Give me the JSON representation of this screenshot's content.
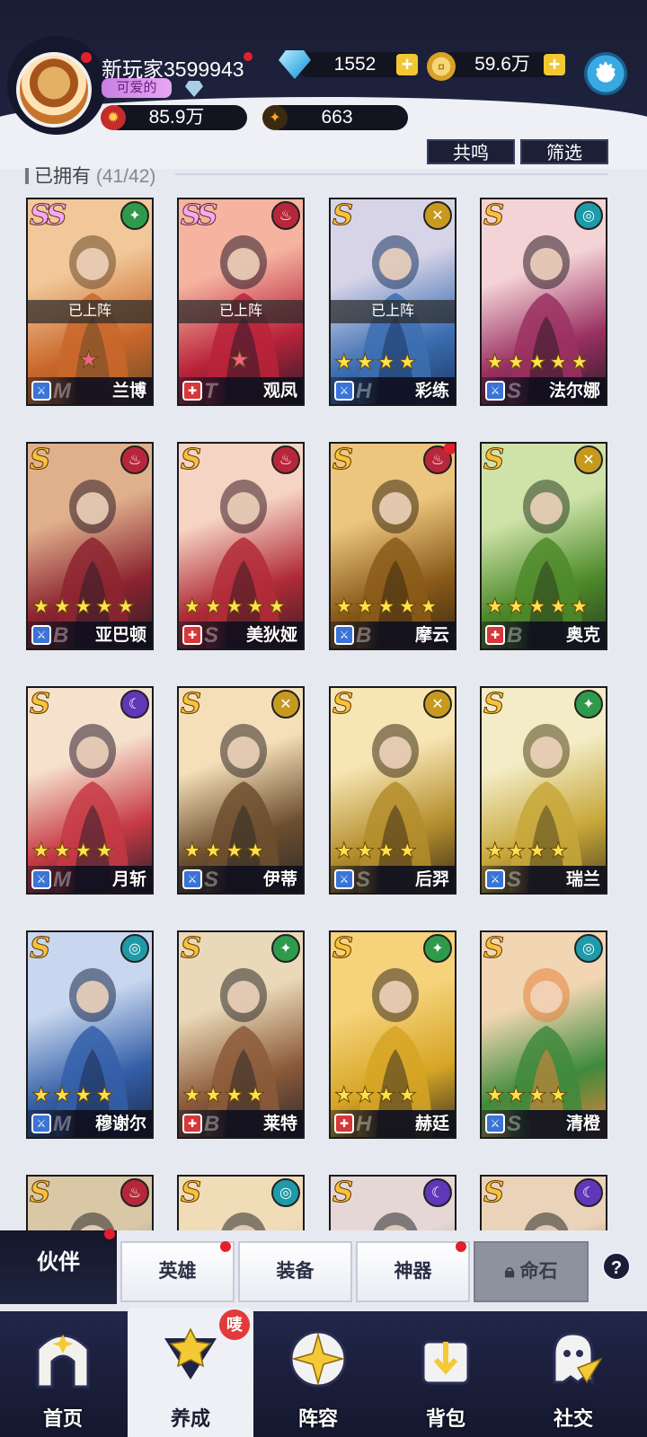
{
  "player": {
    "name": "新玩家3599943",
    "title": "可爱的",
    "power": "85.9万",
    "stars": "663"
  },
  "currency": {
    "diamonds": "1552",
    "gold": "59.6万"
  },
  "actions": {
    "resonance": "共鸣",
    "filter": "筛选"
  },
  "owned": {
    "label": "已拥有",
    "count": "(41/42)"
  },
  "deployed_label": "已上阵",
  "heroes": [
    {
      "name": "兰博",
      "rank": "SS",
      "faction": "green",
      "stars": 1,
      "star_color": "pink",
      "deployed": true,
      "class": "blue",
      "tier": "M"
    },
    {
      "name": "观凤",
      "rank": "SS",
      "faction": "red",
      "stars": 1,
      "star_color": "pink",
      "deployed": true,
      "class": "red",
      "tier": "T"
    },
    {
      "name": "彩练",
      "rank": "S",
      "faction": "gold",
      "stars": 4,
      "star_color": "gold",
      "deployed": true,
      "class": "blue",
      "tier": "H"
    },
    {
      "name": "法尔娜",
      "rank": "S",
      "faction": "teal",
      "stars": 5,
      "star_color": "gold",
      "deployed": false,
      "class": "blue",
      "tier": "S"
    },
    {
      "name": "亚巴顿",
      "rank": "S",
      "faction": "red",
      "stars": 5,
      "star_color": "gold",
      "deployed": false,
      "class": "blue",
      "tier": "B"
    },
    {
      "name": "美狄娅",
      "rank": "S",
      "faction": "red",
      "stars": 5,
      "star_color": "gold",
      "deployed": false,
      "class": "red",
      "tier": "S"
    },
    {
      "name": "摩云",
      "rank": "S",
      "faction": "red",
      "stars": 5,
      "star_color": "gold",
      "deployed": false,
      "class": "blue",
      "tier": "B",
      "alert": true
    },
    {
      "name": "奥克",
      "rank": "S",
      "faction": "gold",
      "stars": 5,
      "star_color": "gold",
      "deployed": false,
      "class": "red",
      "tier": "B"
    },
    {
      "name": "月斩",
      "rank": "S",
      "faction": "purple",
      "stars": 4,
      "star_color": "gold",
      "deployed": false,
      "class": "blue",
      "tier": "M"
    },
    {
      "name": "伊蒂",
      "rank": "S",
      "faction": "gold",
      "stars": 4,
      "star_color": "gold",
      "deployed": false,
      "class": "blue",
      "tier": "S"
    },
    {
      "name": "后羿",
      "rank": "S",
      "faction": "gold",
      "stars": 4,
      "star_color": "gold",
      "deployed": false,
      "class": "blue",
      "tier": "S"
    },
    {
      "name": "瑞兰",
      "rank": "S",
      "faction": "green",
      "stars": 4,
      "star_color": "gold",
      "deployed": false,
      "class": "blue",
      "tier": "S"
    },
    {
      "name": "穆谢尔",
      "rank": "S",
      "faction": "teal",
      "stars": 4,
      "star_color": "gold",
      "deployed": false,
      "class": "blue",
      "tier": "M"
    },
    {
      "name": "莱特",
      "rank": "S",
      "faction": "green",
      "stars": 4,
      "star_color": "gold",
      "deployed": false,
      "class": "red",
      "tier": "B"
    },
    {
      "name": "赫廷",
      "rank": "S",
      "faction": "green",
      "stars": 4,
      "star_color": "gold",
      "deployed": false,
      "class": "red",
      "tier": "H"
    },
    {
      "name": "清橙",
      "rank": "S",
      "faction": "teal",
      "stars": 4,
      "star_color": "gold",
      "deployed": false,
      "class": "blue",
      "tier": "S"
    },
    {
      "name": "",
      "rank": "S",
      "faction": "red",
      "stars": 0,
      "star_color": "gold",
      "deployed": false,
      "class": "blue",
      "tier": ""
    },
    {
      "name": "",
      "rank": "S",
      "faction": "teal",
      "stars": 0,
      "star_color": "gold",
      "deployed": false,
      "class": "blue",
      "tier": ""
    },
    {
      "name": "",
      "rank": "S",
      "faction": "purple",
      "stars": 0,
      "star_color": "gold",
      "deployed": false,
      "class": "blue",
      "tier": ""
    },
    {
      "name": "",
      "rank": "S",
      "faction": "purple",
      "stars": 0,
      "star_color": "gold",
      "deployed": false,
      "class": "blue",
      "tier": ""
    }
  ],
  "subtabs": {
    "partners": "伙伴",
    "heroes": "英雄",
    "equipment": "装备",
    "artifacts": "神器",
    "fatestone": "命石",
    "help": "?"
  },
  "nav": {
    "home": "首页",
    "develop": "养成",
    "develop_badge": "唛",
    "lineup": "阵容",
    "bag": "背包",
    "social": "社交"
  },
  "colors": {
    "faction_green": "#2f9a4b",
    "faction_red": "#b7263a",
    "faction_gold": "#c79a1f",
    "faction_teal": "#1e9aa8",
    "faction_purple": "#5f37b8",
    "class_blue": "#3a74d6",
    "class_red": "#d6383a",
    "header_bg": "#1a1d33"
  }
}
